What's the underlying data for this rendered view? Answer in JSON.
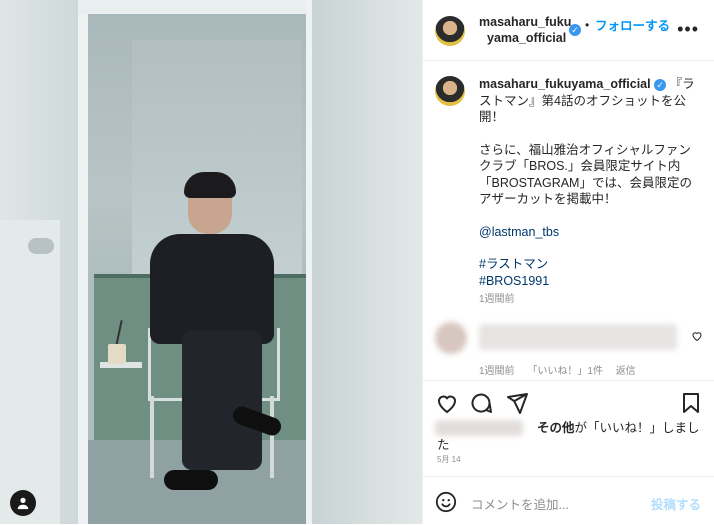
{
  "post_header": {
    "username": "masaharu_fuku",
    "username_cont": "yama_official",
    "verified_mark": "✓",
    "separator": "•",
    "follow_label": "フォローする",
    "more_label": "•••"
  },
  "caption": {
    "username": "masaharu_fukuyama_official",
    "verified_mark": "✓",
    "line1": "『ラストマン』第4話のオフショットを公開！",
    "paragraph2": "さらに、福山雅治オフィシャルファンクラブ「BROS.」会員限定サイト内「BROSTAGRAM」では、会員限定のアザーカットを掲載中！",
    "mention": "@lastman_tbs",
    "hashtag1": "#ラストマン",
    "hashtag2": "#BROS1991",
    "time": "1週間前"
  },
  "comment": {
    "time": "1週間前",
    "likes": "「いいね！」1件",
    "reply": "返信"
  },
  "actions": {
    "like_icon": "heart-icon",
    "comment_icon": "comment-icon",
    "share_icon": "share-icon",
    "save_icon": "bookmark-icon"
  },
  "likes": {
    "text_bold": "その他",
    "text_rest": "が「いいね！」しました",
    "date": "5月 14"
  },
  "add_comment": {
    "placeholder": "コメントを追加...",
    "post_label": "投稿する"
  },
  "colors": {
    "accent": "#0095f6",
    "link": "#00376b",
    "muted": "#8e8e8e"
  }
}
